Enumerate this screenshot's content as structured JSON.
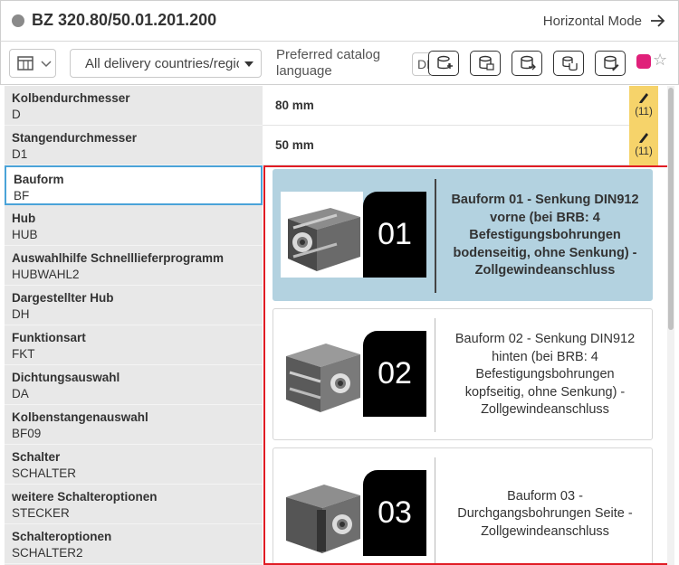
{
  "header": {
    "title": "BZ 320.80/50.01.201.200",
    "mode_label": "Horizontal Mode"
  },
  "toolbar": {
    "country_select": "All delivery countries/regions",
    "language_label": "Preferred catalog language",
    "language_value": "DE",
    "icon_buttons": [
      "database-add-icon",
      "database-export-icon",
      "database-arrow-icon",
      "database-copy-icon",
      "database-edit-icon"
    ],
    "accent_color": "#e0207a"
  },
  "attributes": [
    {
      "name": "Kolbendurchmesser",
      "code": "D"
    },
    {
      "name": "Stangendurchmesser",
      "code": "D1"
    },
    {
      "name": "Bauform",
      "code": "BF"
    },
    {
      "name": "Hub",
      "code": "HUB"
    },
    {
      "name": "Auswahlhilfe Schnelllieferprogramm",
      "code": "HUBWAHL2"
    },
    {
      "name": "Dargestellter Hub",
      "code": "DH"
    },
    {
      "name": "Funktionsart",
      "code": "FKT"
    },
    {
      "name": "Dichtungsauswahl",
      "code": "DA"
    },
    {
      "name": "Kolbenstangenauswahl",
      "code": "BF09"
    },
    {
      "name": "Schalter",
      "code": "SCHALTER"
    },
    {
      "name": "weitere Schalteroptionen",
      "code": "STECKER"
    },
    {
      "name": "Schalteroptionen",
      "code": "SCHALTER2"
    }
  ],
  "values": [
    {
      "value": "80 mm",
      "count": "(11)"
    },
    {
      "value": "50 mm",
      "count": "(11)"
    }
  ],
  "options": [
    {
      "number": "01",
      "label": "Bauform 01 - Senkung DIN912 vorne (bei BRB: 4 Befestigungsbohrungen bodenseitig, ohne Senkung) - Zollgewindeanschluss"
    },
    {
      "number": "02",
      "label": "Bauform 02 - Senkung DIN912 hinten (bei BRB: 4 Befestigungsbohrungen kopfseitig, ohne Senkung) - Zollgewindeanschluss"
    },
    {
      "number": "03",
      "label": "Bauform 03 - Durchgangsbohrungen Seite - Zollgewindeanschluss"
    }
  ],
  "colors": {
    "selected_option": "#b3d2e0",
    "highlight_border": "#e01c24",
    "edit_badge": "#f6d36a",
    "selected_item_border": "#4aa3d8"
  }
}
